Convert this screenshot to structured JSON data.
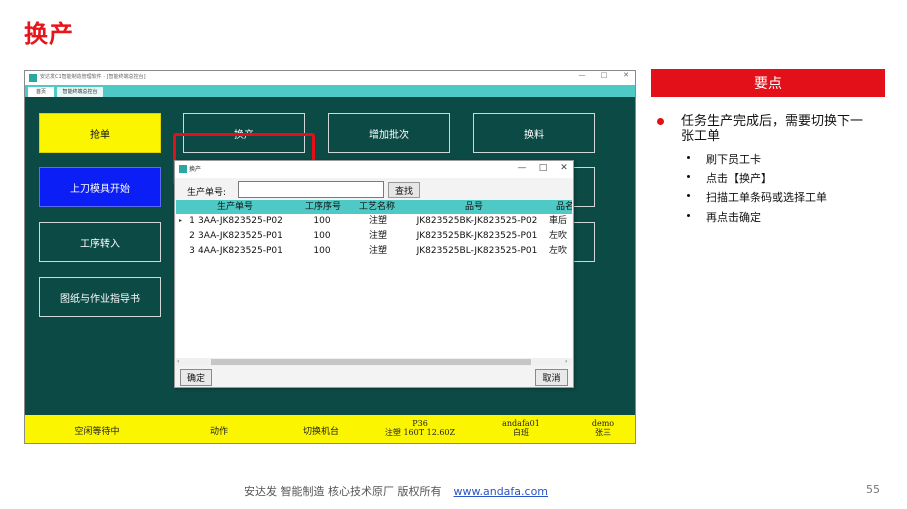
{
  "slide": {
    "title": "换产",
    "page_number": "55",
    "footer": {
      "text": "安达发   智能制造 核心技术原厂    版权所有",
      "link": "www.andafa.com"
    }
  },
  "app": {
    "window_title": "安达发C1智能制造管理软件 - [智能终端总控台]",
    "window_controls": {
      "minimize": "—",
      "maximize": "□",
      "close": "✕"
    },
    "tabs": [
      {
        "label": "首页"
      },
      {
        "label": "智能终端总控台"
      }
    ],
    "buttons": {
      "grab": "抢单",
      "change": "换产",
      "add_batch": "增加批次",
      "change_material": "换料",
      "mold_start": "上刀模具开始",
      "process_transfer": "工序转入",
      "drawings": "图纸与作业指导书"
    },
    "status": {
      "state": "空闲等待中",
      "action": "动作",
      "switch_machine": "切换机台",
      "machine_line1": "P36",
      "machine_line2": "注塑 160T 12.60Z",
      "operator_line1": "andafa01",
      "operator_line2": "白班",
      "user_line1": "demo",
      "user_line2": "张三"
    },
    "colors": {
      "main_bg": "#0c4a46",
      "tab_bar": "#4ec9c5",
      "status_bar": "#fbf600",
      "highlight": "#e3101a"
    }
  },
  "dialog": {
    "title": "换产",
    "window_controls": {
      "minimize": "—",
      "maximize": "□",
      "close": "✕"
    },
    "order_label": "生产单号:",
    "order_value": "",
    "search_label": "查找",
    "columns": [
      "生产单号",
      "工序序号",
      "工艺名称",
      "品号",
      "品名"
    ],
    "rows": [
      {
        "index": "1",
        "order": "3AA-JK823525-P02",
        "seq": "100",
        "process": "注塑",
        "part": "JK823525BK-JK823525-P02",
        "name": "車后"
      },
      {
        "index": "2",
        "order": "3AA-JK823525-P01",
        "seq": "100",
        "process": "注塑",
        "part": "JK823525BK-JK823525-P01",
        "name": "左吹"
      },
      {
        "index": "3",
        "order": "4AA-JK823525-P01",
        "seq": "100",
        "process": "注塑",
        "part": "JK823525BL-JK823525-P01",
        "name": "左吹"
      }
    ],
    "confirm_label": "确定",
    "cancel_label": "取消"
  },
  "panel": {
    "header": "要点",
    "main_point": "任务生产完成后，需要切换下一张工单",
    "steps": [
      "刷下员工卡",
      "点击【换产】",
      "扫描工单条码或选择工单",
      "再点击确定"
    ]
  }
}
